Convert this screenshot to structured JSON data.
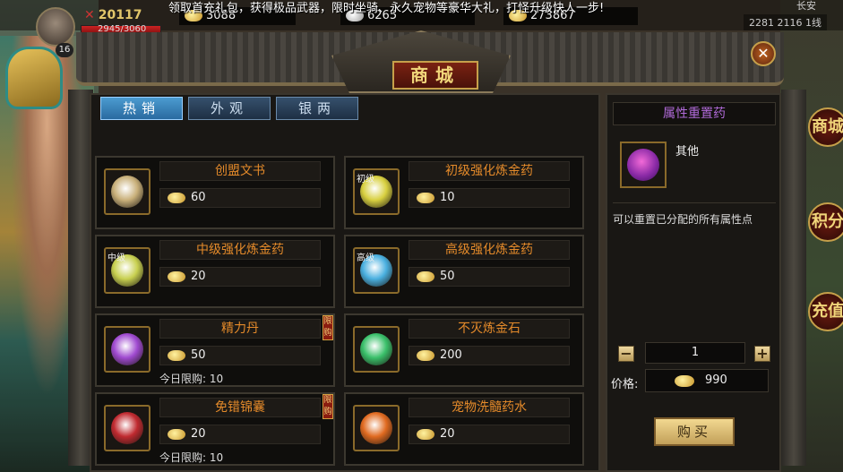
{
  "hud": {
    "level": "16",
    "power": "20117",
    "hp": "2945/3060",
    "gold": "3088",
    "silver": "6265",
    "ingot": "273867",
    "marquee": "领取首充礼包，获得极品武器，限时坐骑、永久宠物等豪华大礼，打怪升级快人一步!",
    "map_name": "长安",
    "coords": "2281 2116",
    "coords_extra": "1线"
  },
  "shop": {
    "title": "商城",
    "close_label": "✕",
    "tabs": [
      {
        "label": "热销",
        "active": true
      },
      {
        "label": "外观",
        "active": false
      },
      {
        "label": "银两",
        "active": false
      }
    ],
    "items": [
      {
        "name": "创盟文书",
        "price": "60",
        "tag": "",
        "limit": "",
        "badge": "",
        "icon_color": "#c9b07a"
      },
      {
        "name": "初级强化炼金药",
        "price": "10",
        "tag": "初级",
        "limit": "",
        "badge": "",
        "icon_color": "#d8d040"
      },
      {
        "name": "中级强化炼金药",
        "price": "20",
        "tag": "中级",
        "limit": "",
        "badge": "",
        "icon_color": "#c8d050"
      },
      {
        "name": "高级强化炼金药",
        "price": "50",
        "tag": "高级",
        "limit": "",
        "badge": "",
        "icon_color": "#4ab0e0"
      },
      {
        "name": "精力丹",
        "price": "50",
        "tag": "",
        "limit": "今日限购: 10",
        "badge": "限购",
        "icon_color": "#a04ad0"
      },
      {
        "name": "不灭炼金石",
        "price": "200",
        "tag": "",
        "limit": "",
        "badge": "",
        "icon_color": "#3ac06a"
      },
      {
        "name": "免错锦囊",
        "price": "20",
        "tag": "",
        "limit": "今日限购: 10",
        "badge": "限购",
        "icon_color": "#c02a30"
      },
      {
        "name": "宠物洗髓药水",
        "price": "20",
        "tag": "",
        "limit": "",
        "badge": "",
        "icon_color": "#e06a20"
      }
    ]
  },
  "detail": {
    "title": "属性重置药",
    "category": "其他",
    "description": "可以重置已分配的所有属性点",
    "quantity": "1",
    "minus": "−",
    "plus": "+",
    "price_label": "价格:",
    "price": "990",
    "buy_label": "购买"
  },
  "right_buttons": [
    "商城",
    "积分",
    "充值"
  ]
}
